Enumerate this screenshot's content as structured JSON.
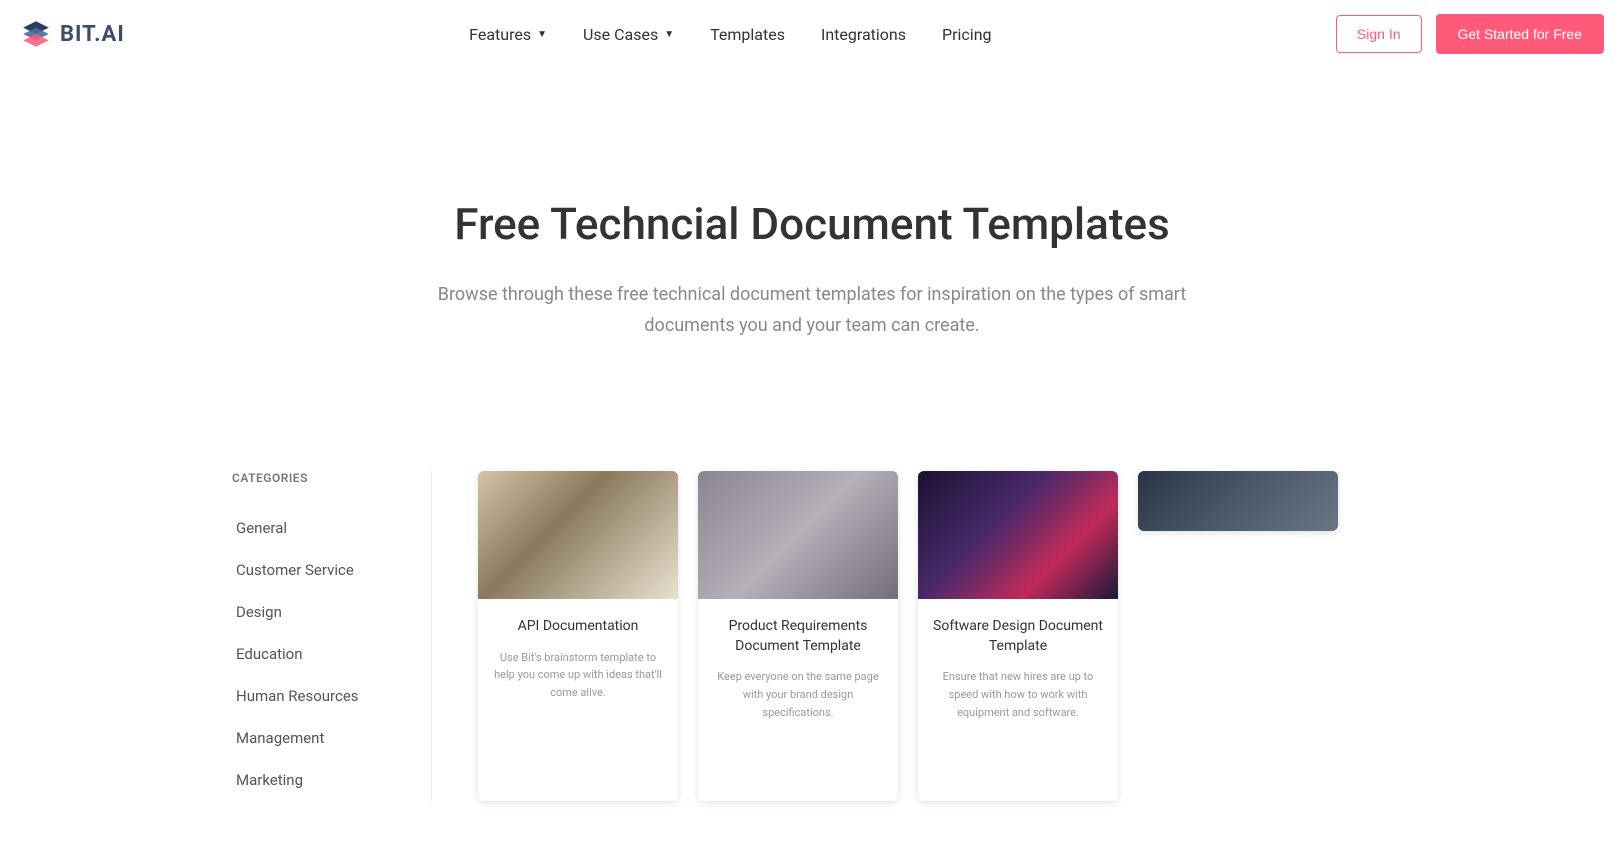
{
  "header": {
    "logo_text": "BIT",
    "logo_suffix": ".AI",
    "nav": [
      {
        "label": "Features",
        "dropdown": true
      },
      {
        "label": "Use Cases",
        "dropdown": true
      },
      {
        "label": "Templates",
        "dropdown": false
      },
      {
        "label": "Integrations",
        "dropdown": false
      },
      {
        "label": "Pricing",
        "dropdown": false
      }
    ],
    "signin": "Sign In",
    "getstarted": "Get Started for Free"
  },
  "hero": {
    "title": "Free Techncial Document Templates",
    "subtitle": "Browse through these free technical document templates for inspiration on the types of smart documents you and your team can create."
  },
  "sidebar": {
    "title": "CATEGORIES",
    "items": [
      "General",
      "Customer Service",
      "Design",
      "Education",
      "Human Resources",
      "Management",
      "Marketing"
    ]
  },
  "cards": [
    {
      "title": "API Documentation",
      "desc": "Use Bit's brainstorm template to help you come up with ideas that'll come alive.",
      "img": "img1"
    },
    {
      "title": "Product Requirements Document Template",
      "desc": "Keep everyone on the same page with your brand design specifications.",
      "img": "img2"
    },
    {
      "title": "Software Design Document Template",
      "desc": "Ensure that new hires are up to speed with how to work with equipment and software.",
      "img": "img3"
    },
    {
      "title": "",
      "desc": "",
      "img": "img4"
    }
  ]
}
